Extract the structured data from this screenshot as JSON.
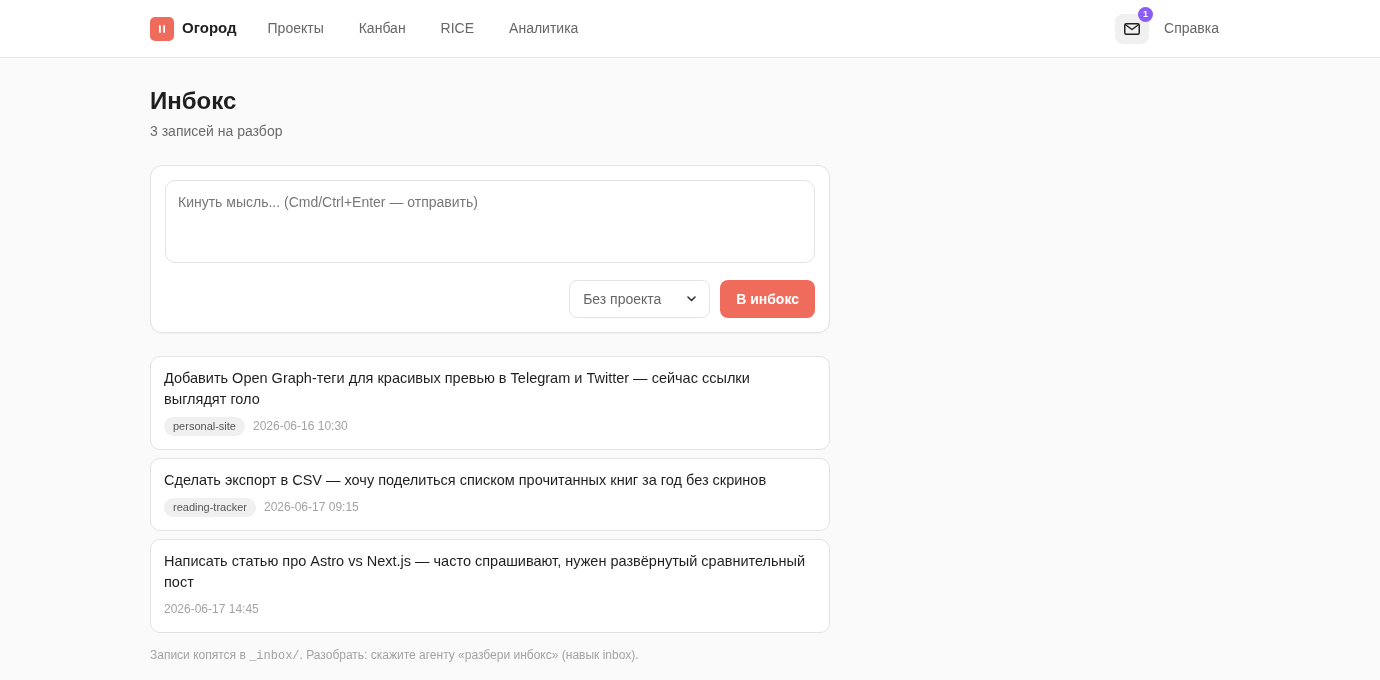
{
  "header": {
    "brand": "Огород",
    "nav": [
      {
        "label": "Проекты",
        "selected": false
      },
      {
        "label": "Канбан",
        "selected": false
      },
      {
        "label": "RICE",
        "selected": false
      },
      {
        "label": "Аналитика",
        "selected": false
      }
    ],
    "inbox_badge": "1",
    "help_link": "Справка"
  },
  "page": {
    "title": "Инбокс",
    "subtitle": "3 записей на разбор"
  },
  "composer": {
    "placeholder": "Кинуть мысль... (Cmd/Ctrl+Enter — отправить)",
    "project_select": "Без проекта",
    "submit": "В инбокс"
  },
  "entries": [
    {
      "text": "Добавить Open Graph-теги для красивых превью в Telegram и Twitter — сейчас ссылки выглядят голо",
      "project": "personal-site",
      "time": "2026-06-16 10:30"
    },
    {
      "text": "Сделать экспорт в CSV — хочу поделиться списком прочитанных книг за год без скринов",
      "project": "reading-tracker",
      "time": "2026-06-17 09:15"
    },
    {
      "text": "Написать статью про Astro vs Next.js — часто спрашивают, нужен развёрнутый сравнительный пост",
      "time": "2026-06-17 14:45"
    }
  ],
  "footer_note": {
    "before": "Записи копятся в ",
    "code": "_inbox/",
    "after": ". Разобрать: скажите агенту «разбери инбокс» (навык inbox)."
  }
}
